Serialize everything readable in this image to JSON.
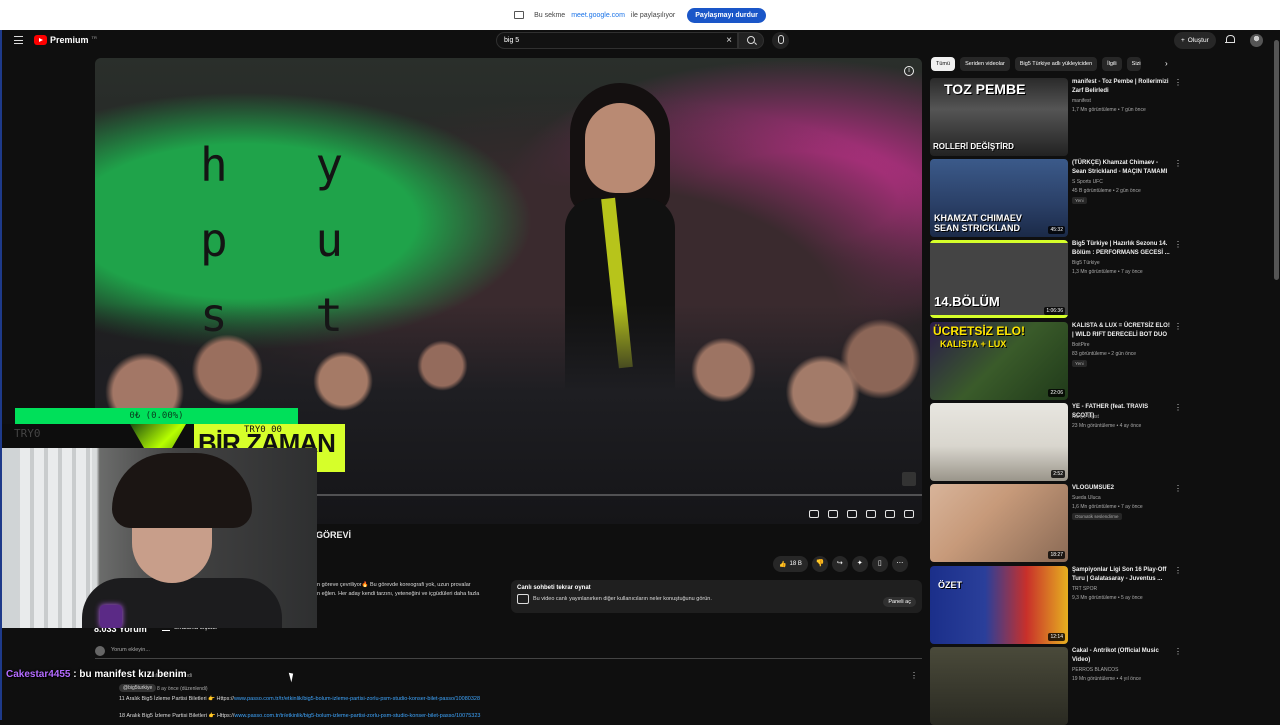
{
  "share_bar": {
    "prefix": "Bu sekme",
    "domain": "meet.google.com",
    "suffix": "ile paylaşılıyor",
    "stop_label": "Paylaşmayı durdur"
  },
  "header": {
    "logo_text": "Premium",
    "logo_sup": "TR",
    "search_value": "big 5",
    "create_label": "Oluştur"
  },
  "video": {
    "title_fragment": "GÖREVİ",
    "likes": "18 B",
    "description_line1": "n göreve çevriliyor🔥 Bu görevde koreografi yok, uzun provalar",
    "description_line2": "n eğlen. Her aday kendi tarzını, yeteneğini ve içgüdüleri daha fazla"
  },
  "live_chat": {
    "header": "Canlı sohbeti tekrar oynat",
    "text": "Bu video canlı yayınlanırken diğer kullanıcıların neler konuştuğunu görün.",
    "button": "Paneli aç"
  },
  "comments": {
    "count": "8.033 Yorum",
    "sort_label": "Sıralama ölçütü:",
    "add_placeholder": "Yorum ekleyin...",
    "pinned_text": "tarafından sabitlendi",
    "author": "@big5turkiye",
    "date": "8 ay önce (düzenlendi)",
    "line1_text": "11 Aralık Big5 İzleme Partisi Biletleri 👉 Https://",
    "line1_url": "www.passo.com.tr/tr/etkinlik/big5-bolum-izleme-partisi-zorlu-psm-studio-konser-bilet-passo/10080328",
    "line2_text": "18 Aralık Big5 İzleme Partisi Biletleri 👉 Https://",
    "line2_url": "www.passo.com.tr/tr/etkinlik/big5-bolum-izleme-partisi-zorlu-psm-studio-konser-bilet-passo/10075323"
  },
  "stream_overlay": {
    "stats": "0₺ (0.00%)",
    "left_tag": "TRY0",
    "banner_text": "BİR ZAMAN",
    "banner_small": "TRY0 00"
  },
  "chat_overlay": {
    "user": "Cakestar4455",
    "message": ": bu manifest kızı benim"
  },
  "sidebar": {
    "chips": [
      "Tümü",
      "Seriden videolar",
      "Big5 Türkiye adlı yükleyiciden",
      "İlgili",
      "Sizin için"
    ],
    "items": [
      {
        "title": "manifest - Toz Pembe | Rollerimizi Zarf Belirledi",
        "channel": "manifest",
        "meta": "1,7 Mn görüntüleme • 7 gün önce",
        "badge": "",
        "duration": "",
        "thumb_text": "TOZ PEMBE",
        "thumb_text2": "ROLLERİ DEĞİŞTİRD"
      },
      {
        "title": "(TÜRKÇE) Khamzat Chimaev - Sean Strickland - MAÇIN TAMAMI",
        "channel": "S Sports UFC",
        "meta": "45 B görüntüleme • 2 gün önce",
        "badge": "Yeni",
        "duration": "45:32",
        "thumb_text": "KHAMZAT CHIMAEV",
        "thumb_text2": "SEAN STRICKLAND"
      },
      {
        "title": "Big5 Türkiye | Hazırlık Sezonu 14. Bölüm : PERFORMANS GECESİ ...",
        "channel": "Big5 Türkiye",
        "meta": "1,3 Mn görüntüleme • 7 ay önce",
        "badge": "",
        "duration": "1:06:36",
        "thumb_text": "14.BÖLÜM",
        "thumb_text2": ""
      },
      {
        "title": "KALISTA & LUX = ÜCRETSİZ ELO! | WILD RIFT DERECELİ BOT DUO",
        "channel": "BoitPire",
        "meta": "83 görüntüleme • 2 gün önce",
        "badge": "Yeni",
        "duration": "22:06",
        "thumb_text": "ÜCRETSİZ ELO!",
        "thumb_text2": "KALISTA + LUX"
      },
      {
        "title": "YE - FATHER (feat. TRAVIS SCOTT)",
        "channel": "Kanye West",
        "meta": "23 Mn görüntüleme • 4 ay önce",
        "badge": "",
        "duration": "2:52",
        "thumb_text": "",
        "thumb_text2": ""
      },
      {
        "title": "VLOGUMSUE2",
        "channel": "Sueda Uluca",
        "meta": "1,6 Mn görüntüleme • 7 ay önce",
        "badge": "Otomatik seslendirme",
        "duration": "18:27",
        "thumb_text": "",
        "thumb_text2": ""
      },
      {
        "title": "Şampiyonlar Ligi Son 16 Play-Off Turu | Galatasaray - Juventus ...",
        "channel": "TRT SPOR",
        "meta": "9,3 Mn görüntüleme • 5 ay önce",
        "badge": "",
        "duration": "12:14",
        "thumb_text": "ÖZET",
        "thumb_text2": ""
      },
      {
        "title": "Cakal - Antrikot (Official Music Video)",
        "channel": "PERROS BLANCOS",
        "meta": "19 Mn görüntüleme • 4 yıl önce",
        "badge": "",
        "duration": "",
        "thumb_text": "",
        "thumb_text2": ""
      }
    ]
  },
  "colors": {
    "yt_red": "#ff0000",
    "link_blue": "#3ea6ff",
    "share_stop": "#1a56c8",
    "stats_green": "#00e05a",
    "banner_yellow": "#d6ff2a",
    "chat_user": "#b36bff"
  }
}
